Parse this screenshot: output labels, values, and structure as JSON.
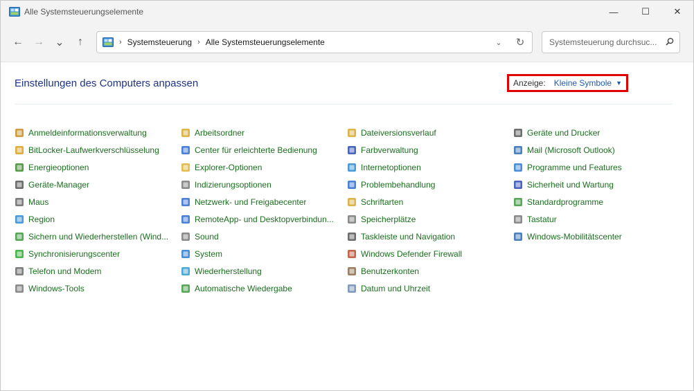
{
  "window": {
    "title": "Alle Systemsteuerungselemente",
    "minimize_glyph": "—",
    "maximize_glyph": "☐",
    "close_glyph": "✕"
  },
  "nav": {
    "back_glyph": "←",
    "forward_glyph": "→",
    "recent_glyph": "⌄",
    "up_glyph": "↑",
    "breadcrumb": [
      "Systemsteuerung",
      "Alle Systemsteuerungselemente"
    ],
    "crumb_sep": "›",
    "dropdown_glyph": "⌄",
    "refresh_glyph": "↻",
    "search_placeholder": "Systemsteuerung durchsuc...",
    "search_value": ""
  },
  "header": {
    "title": "Einstellungen des Computers anpassen",
    "view_label": "Anzeige:",
    "view_value": "Kleine Symbole",
    "view_caret": "▼"
  },
  "colors": {
    "link": "#1a6e1e",
    "title": "#1e3287",
    "highlight_border": "#e00000"
  },
  "items": [
    {
      "label": "Anmeldeinformationsverwaltung",
      "icon": "credential-icon",
      "color": "#c98a1c"
    },
    {
      "label": "BitLocker-Laufwerkverschlüsselung",
      "icon": "bitlocker-icon",
      "color": "#d8a020"
    },
    {
      "label": "Energieoptionen",
      "icon": "power-icon",
      "color": "#3b8a2a"
    },
    {
      "label": "Geräte-Manager",
      "icon": "device-manager-icon",
      "color": "#555555"
    },
    {
      "label": "Maus",
      "icon": "mouse-icon",
      "color": "#666666"
    },
    {
      "label": "Region",
      "icon": "region-icon",
      "color": "#2a8ad0"
    },
    {
      "label": "Sichern und Wiederherstellen (Wind...",
      "icon": "backup-icon",
      "color": "#3a9a3a"
    },
    {
      "label": "Synchronisierungscenter",
      "icon": "sync-icon",
      "color": "#2ea82e"
    },
    {
      "label": "Telefon und Modem",
      "icon": "phone-icon",
      "color": "#666666"
    },
    {
      "label": "Windows-Tools",
      "icon": "tools-icon",
      "color": "#777777"
    },
    {
      "label": "Arbeitsordner",
      "icon": "work-folders-icon",
      "color": "#d6a72a"
    },
    {
      "label": "Center für erleichterte Bedienung",
      "icon": "accessibility-icon",
      "color": "#2a6ad0"
    },
    {
      "label": "Explorer-Optionen",
      "icon": "folder-options-icon",
      "color": "#e0b030"
    },
    {
      "label": "Indizierungsoptionen",
      "icon": "indexing-icon",
      "color": "#777777"
    },
    {
      "label": "Netzwerk- und Freigabecenter",
      "icon": "network-icon",
      "color": "#2a6ad0"
    },
    {
      "label": "RemoteApp- und Desktopverbindun...",
      "icon": "remoteapp-icon",
      "color": "#2a6ad0"
    },
    {
      "label": "Sound",
      "icon": "sound-icon",
      "color": "#777777"
    },
    {
      "label": "System",
      "icon": "system-icon",
      "color": "#2a7ad0"
    },
    {
      "label": "Wiederherstellung",
      "icon": "recovery-icon",
      "color": "#2a9ad0"
    },
    {
      "label": "Automatische Wiedergabe",
      "icon": "autoplay-icon",
      "color": "#3a9a3a"
    },
    {
      "label": "Dateiversionsverlauf",
      "icon": "file-history-icon",
      "color": "#d6a72a"
    },
    {
      "label": "Farbverwaltung",
      "icon": "color-management-icon",
      "color": "#2a4ab0"
    },
    {
      "label": "Internetoptionen",
      "icon": "internet-options-icon",
      "color": "#2a8ad0"
    },
    {
      "label": "Problembehandlung",
      "icon": "troubleshoot-icon",
      "color": "#2a6ad0"
    },
    {
      "label": "Schriftarten",
      "icon": "fonts-icon",
      "color": "#d6a72a"
    },
    {
      "label": "Speicherplätze",
      "icon": "storage-spaces-icon",
      "color": "#777777"
    },
    {
      "label": "Taskleiste und Navigation",
      "icon": "taskbar-icon",
      "color": "#555555"
    },
    {
      "label": "Windows Defender Firewall",
      "icon": "firewall-icon",
      "color": "#b84a2a"
    },
    {
      "label": "Benutzerkonten",
      "icon": "user-accounts-icon",
      "color": "#8a6a4a"
    },
    {
      "label": "Datum und Uhrzeit",
      "icon": "date-time-icon",
      "color": "#6a8ab0"
    },
    {
      "label": "Geräte und Drucker",
      "icon": "devices-printers-icon",
      "color": "#555555"
    },
    {
      "label": "Mail (Microsoft Outlook)",
      "icon": "mail-icon",
      "color": "#2a6ab0"
    },
    {
      "label": "Programme und Features",
      "icon": "programs-icon",
      "color": "#2a7ad0"
    },
    {
      "label": "Sicherheit und Wartung",
      "icon": "security-flag-icon",
      "color": "#2a4ab0"
    },
    {
      "label": "Standardprogramme",
      "icon": "default-programs-icon",
      "color": "#3a9a3a"
    },
    {
      "label": "Tastatur",
      "icon": "keyboard-icon",
      "color": "#777777"
    },
    {
      "label": "Windows-Mobilitätscenter",
      "icon": "mobility-center-icon",
      "color": "#2a6ab0"
    }
  ]
}
